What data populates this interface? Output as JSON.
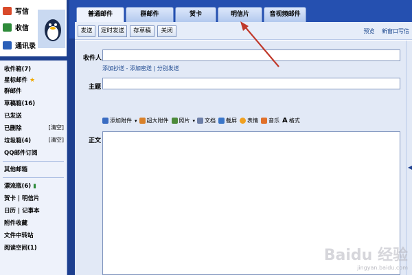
{
  "sidebar_top": {
    "write": "写信",
    "inbox": "收信",
    "contacts": "通讯录"
  },
  "sidebar_nav": {
    "inbox": "收件箱(7)",
    "starred": "星标邮件",
    "group_mail": "群邮件",
    "drafts": "草稿箱(16)",
    "sent": "已发送",
    "deleted": "已删除",
    "deleted_action": "[清空]",
    "spam": "垃圾箱(4)",
    "spam_action": "[清空]",
    "qq_subscribe": "QQ邮件订阅",
    "other_mailbox": "其他邮箱",
    "reminder": "漂流瓶(6)",
    "card_postcard": "贺卡 | 明信片",
    "calendar_notes": "日历 | 记事本",
    "attachments": "附件收藏",
    "file_transfer": "文件中转站",
    "reading_space": "阅读空间(1)"
  },
  "tabs": [
    {
      "label": "普通邮件"
    },
    {
      "label": "群邮件"
    },
    {
      "label": "贺卡"
    },
    {
      "label": "明信片"
    },
    {
      "label": "音视频邮件"
    }
  ],
  "toolbar": {
    "send": "发送",
    "scheduled_send": "定时发送",
    "save_draft": "存草稿",
    "close": "关闭",
    "preview": "预览",
    "new_window": "新窗口写信"
  },
  "form": {
    "to_label": "收件人",
    "to_value": "",
    "recipient_links": "添加抄送 - 添加密送 | 分别发送",
    "subject_label": "主题",
    "subject_value": "",
    "body_label": "正文",
    "body_value": ""
  },
  "editor_tools": {
    "attach": "添加附件",
    "big_attach": "超大附件",
    "photo": "照片",
    "document": "文档",
    "screenshot": "截屏",
    "emoticon": "表情",
    "music": "音乐",
    "format": "格式"
  },
  "watermark": {
    "brand": "Baidu 经验",
    "url": "jingyan.baidu.com"
  },
  "colors": {
    "frame_blue": "#1d3f8f",
    "bar_blue": "#2550b0",
    "panel": "#e2e9f6",
    "annotation_red": "#c0392b"
  }
}
